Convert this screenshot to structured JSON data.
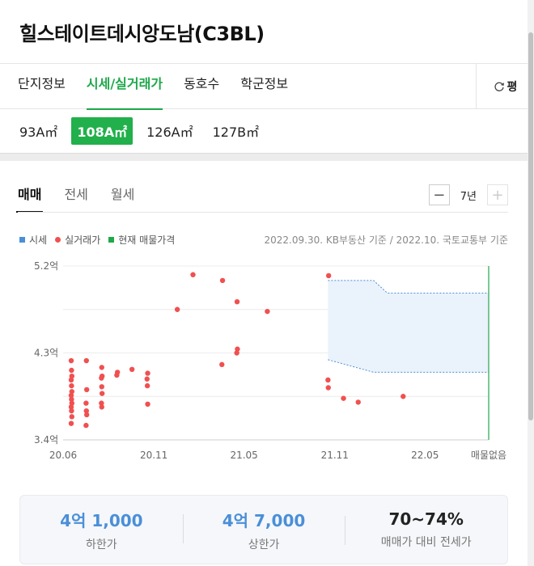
{
  "header": {
    "title": "힐스테이트데시앙도남(C3BL)"
  },
  "tabs": [
    {
      "label": "단지정보",
      "active": false
    },
    {
      "label": "시세/실거래가",
      "active": true
    },
    {
      "label": "동호수",
      "active": false
    },
    {
      "label": "학군정보",
      "active": false
    }
  ],
  "compare_button": {
    "label": "평",
    "icon": "refresh-icon"
  },
  "areas": [
    {
      "label": "93A㎡",
      "active": false
    },
    {
      "label": "108A㎡",
      "active": true
    },
    {
      "label": "126A㎡",
      "active": false
    },
    {
      "label": "127B㎡",
      "active": false
    }
  ],
  "deal_tabs": [
    {
      "label": "매매",
      "active": true
    },
    {
      "label": "전세",
      "active": false
    },
    {
      "label": "월세",
      "active": false
    }
  ],
  "period": {
    "value": "7년",
    "minus": "−",
    "plus": "+"
  },
  "legend": {
    "items": [
      {
        "label": "시세",
        "color": "#4a8fd8",
        "shape": "square"
      },
      {
        "label": "실거래가",
        "color": "#f05050",
        "shape": "circle"
      },
      {
        "label": "현재 매물가격",
        "color": "#21a84a",
        "shape": "square"
      }
    ],
    "basis": "2022.09.30. KB부동산 기준 / 2022.10. 국토교통부 기준"
  },
  "chart_data": {
    "type": "scatter",
    "y_unit": "억",
    "ylim": [
      3.4,
      5.2
    ],
    "y_ticks": [
      "5.2억",
      "4.3억",
      "3.4억"
    ],
    "x_ticks": [
      "20.06",
      "20.11",
      "21.05",
      "21.11",
      "22.05",
      "매물없음"
    ],
    "grid": true,
    "series": [
      {
        "name": "실거래가",
        "points": [
          [
            "2020-06",
            4.22
          ],
          [
            "2020-06",
            4.12
          ],
          [
            "2020-06",
            4.06
          ],
          [
            "2020-06",
            4.02
          ],
          [
            "2020-06",
            3.96
          ],
          [
            "2020-06",
            3.9
          ],
          [
            "2020-06",
            3.86
          ],
          [
            "2020-06",
            3.82
          ],
          [
            "2020-06",
            3.78
          ],
          [
            "2020-06",
            3.74
          ],
          [
            "2020-06",
            3.7
          ],
          [
            "2020-06",
            3.64
          ],
          [
            "2020-06",
            3.57
          ],
          [
            "2020-07",
            4.22
          ],
          [
            "2020-07",
            3.92
          ],
          [
            "2020-07",
            3.78
          ],
          [
            "2020-07",
            3.7
          ],
          [
            "2020-07",
            3.66
          ],
          [
            "2020-07",
            3.55
          ],
          [
            "2020-08",
            4.15
          ],
          [
            "2020-08",
            4.06
          ],
          [
            "2020-08",
            4.04
          ],
          [
            "2020-08",
            3.95
          ],
          [
            "2020-08",
            3.88
          ],
          [
            "2020-08",
            3.78
          ],
          [
            "2020-08",
            3.74
          ],
          [
            "2020-09",
            4.1
          ],
          [
            "2020-09",
            4.07
          ],
          [
            "2020-10",
            4.13
          ],
          [
            "2020-11",
            4.09
          ],
          [
            "2020-11",
            4.03
          ],
          [
            "2020-11",
            3.96
          ],
          [
            "2020-11",
            3.77
          ],
          [
            "2021-01",
            4.75
          ],
          [
            "2021-02",
            5.11
          ],
          [
            "2021-04",
            5.05
          ],
          [
            "2021-04",
            4.18
          ],
          [
            "2021-05",
            4.83
          ],
          [
            "2021-05",
            4.34
          ],
          [
            "2021-05",
            4.3
          ],
          [
            "2021-07",
            4.73
          ],
          [
            "2021-11",
            5.1
          ],
          [
            "2021-11",
            4.02
          ],
          [
            "2021-11",
            3.94
          ],
          [
            "2021-12",
            3.83
          ],
          [
            "2022-01",
            3.79
          ],
          [
            "2022-04",
            3.85
          ]
        ]
      },
      {
        "name": "시세",
        "start": "2021-11",
        "end": "2022-10",
        "upper": [
          [
            "2021-11",
            5.05
          ],
          [
            "2022-02",
            5.05
          ],
          [
            "2022-03",
            4.92
          ],
          [
            "2022-10",
            4.92
          ]
        ],
        "lower": [
          [
            "2021-11",
            4.23
          ],
          [
            "2022-02",
            4.1
          ],
          [
            "2022-10",
            4.1
          ]
        ]
      }
    ],
    "current_listing": "매물없음"
  },
  "summary": [
    {
      "value": "4억 1,000",
      "label": "하한가",
      "accent": true
    },
    {
      "value": "4억 7,000",
      "label": "상한가",
      "accent": true
    },
    {
      "value": "70~74%",
      "label": "매매가 대비 전세가",
      "accent": false
    }
  ]
}
